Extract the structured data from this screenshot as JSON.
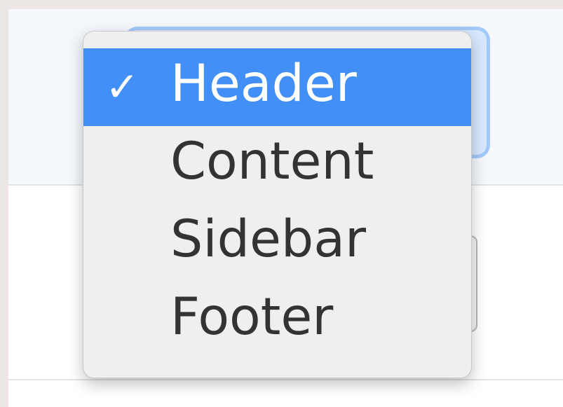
{
  "dropdown": {
    "items": [
      {
        "label": "Header",
        "selected": true,
        "check": "✓"
      },
      {
        "label": "Content",
        "selected": false
      },
      {
        "label": "Sidebar",
        "selected": false
      },
      {
        "label": "Footer",
        "selected": false
      }
    ]
  },
  "colors": {
    "selection": "#418ff7",
    "menu_background": "#efefef",
    "text": "#333333",
    "selected_text": "#ffffff",
    "page_background": "#ece7e4"
  },
  "icons": {
    "checkmark": "checkmark-icon"
  }
}
